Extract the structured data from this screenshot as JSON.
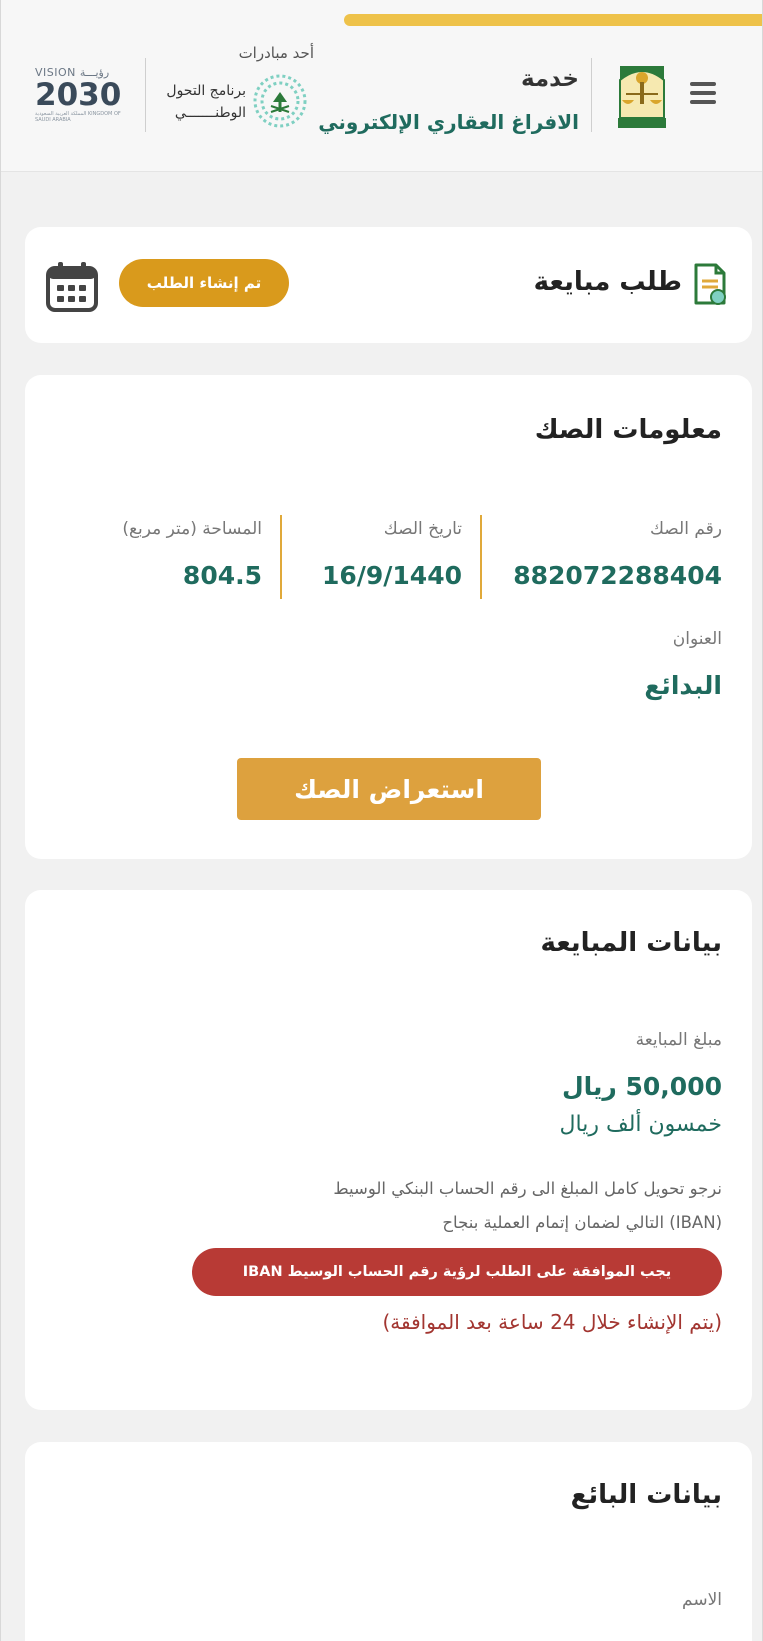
{
  "header": {
    "progress_fraction": 0.55,
    "progress_color": "#eec24a",
    "menu_icon": "hamburger-menu-icon",
    "service_title": "خدمة",
    "service_subtitle": "الافراغ العقاري الإلكتروني",
    "initiative_label": "أحد مبادرات",
    "ntp_line1": "برنامج التحول",
    "ntp_line2": "الوطنـــــــي",
    "vision_line1": "VISION رؤيـــة",
    "vision_year": "2030",
    "vision_line3": "المملكة العربية السعودية KINGDOM OF SAUDI ARABIA"
  },
  "request_card": {
    "title": "طلب مبايعة",
    "status_badge": "تم إنشاء الطلب",
    "status_color": "#d99a1c",
    "calendar_icon": "calendar-icon"
  },
  "deed_info": {
    "title": "معلومات الصك",
    "deed_number_label": "رقم الصك",
    "deed_number": "882072288404",
    "deed_date_label": "تاريخ الصك",
    "deed_date": "16/9/1440",
    "area_label": "المساحة (متر مربع)",
    "area": "804.5",
    "address_label": "العنوان",
    "address": "البدائع",
    "view_button": "استعراض الصك"
  },
  "sale_info": {
    "title": "بيانات المبايعة",
    "amount_label": "مبلغ المبايعة",
    "amount": "50,000 ريال",
    "amount_words": "خمسون ألف ريال",
    "note_line1": "نرجو تحويل كامل المبلغ الى رقم الحساب البنكي الوسيط",
    "note_line2": "(IBAN) التالي لضمان إتمام العملية بنجاح",
    "warning_pill": "يجب الموافقة على الطلب لرؤية رقم الحساب الوسيط IBAN",
    "warning_note": "(يتم الإنشاء خلال 24 ساعة بعد الموافقة)"
  },
  "seller_info": {
    "title": "بيانات البائع",
    "name_label": "الاسم"
  },
  "colors": {
    "accent_gold": "#dda13e",
    "value_green": "#1f6b5e",
    "warning_red": "#b83a35"
  }
}
